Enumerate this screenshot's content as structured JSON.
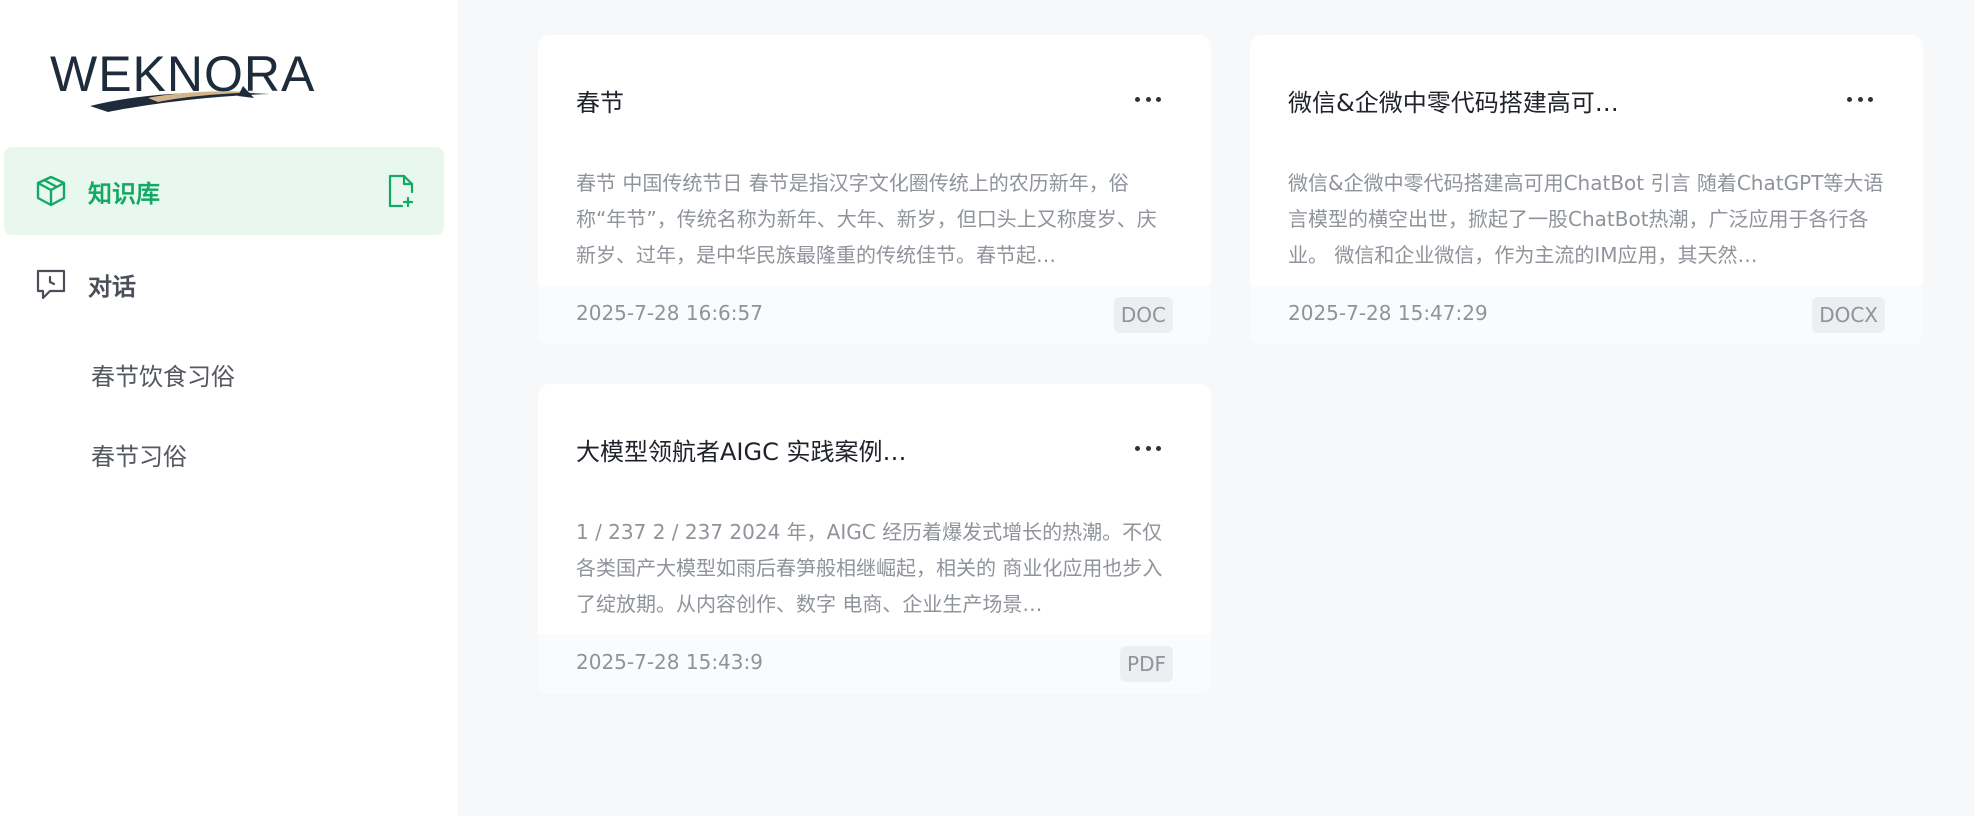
{
  "logo": {
    "text": "WEKNORA"
  },
  "sidebar": {
    "items": [
      {
        "label": "知识库",
        "active": true
      },
      {
        "label": "对话",
        "active": false
      }
    ],
    "sub_items": [
      {
        "label": "春节饮食习俗"
      },
      {
        "label": "春节习俗"
      }
    ]
  },
  "cards": [
    {
      "title": "春节",
      "description": "春节 中国传统节日 春节是指汉字文化圈传统上的农历新年，俗称“年节”，传统名称为新年、大年、新岁，但口头上又称度岁、庆新岁、过年，是中华民族最隆重的传统佳节。春节起…",
      "date": "2025-7-28 16:6:57",
      "type": "DOC"
    },
    {
      "title": "微信&企微中零代码搭建高可…",
      "description": "微信&企微中零代码搭建高可用ChatBot 引言 随着ChatGPT等大语言模型的横空出世，掀起了一股ChatBot热潮，广泛应用于各行各业。 微信和企业微信，作为主流的IM应用，其天然…",
      "date": "2025-7-28 15:47:29",
      "type": "DOCX"
    },
    {
      "title": "大模型领航者AIGC 实践案例…",
      "description": "1 / 237 2 / 237 2024 年，AIGC 经历着爆发式增长的热潮。不仅 各类国产大模型如雨后春笋般相继崛起，相关的 商业化应用也步入了绽放期。从内容创作、数字 电商、企业生产场景…",
      "date": "2025-7-28 15:43:9",
      "type": "PDF"
    }
  ],
  "colors": {
    "accent": "#14a865",
    "active_bg": "#e8f8ef",
    "text_primary": "#1f2329",
    "text_muted": "#8f939a"
  }
}
